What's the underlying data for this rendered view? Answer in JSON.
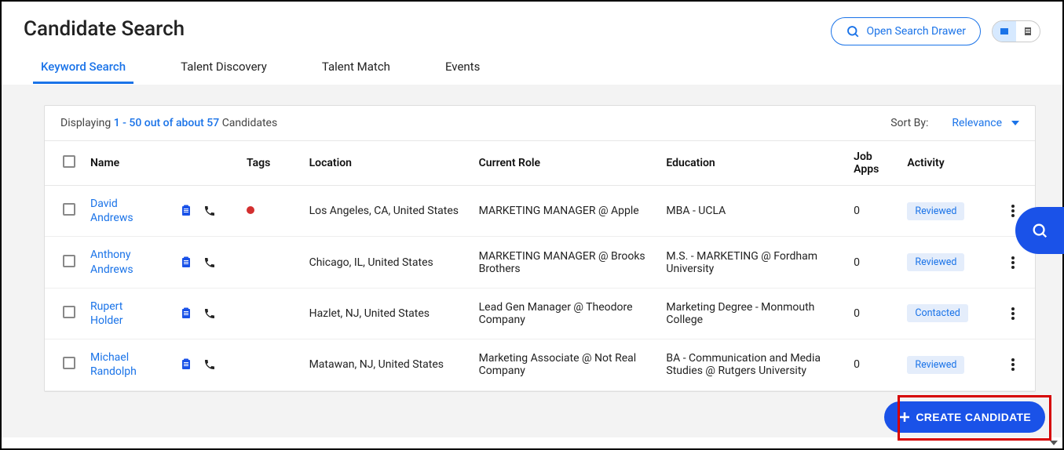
{
  "header": {
    "title": "Candidate Search",
    "open_search_drawer": "Open Search Drawer"
  },
  "tabs": [
    {
      "label": "Keyword Search",
      "active": true
    },
    {
      "label": "Talent Discovery",
      "active": false
    },
    {
      "label": "Talent Match",
      "active": false
    },
    {
      "label": "Events",
      "active": false
    }
  ],
  "results_bar": {
    "displaying_prefix": "Displaying ",
    "count_range": "1 - 50 out of about 57",
    "displaying_suffix": " Candidates",
    "sort_label": "Sort By:",
    "sort_value": "Relevance"
  },
  "columns": {
    "name": "Name",
    "tags": "Tags",
    "location": "Location",
    "current_role": "Current Role",
    "education": "Education",
    "job_apps": "Job Apps",
    "activity": "Activity"
  },
  "rows": [
    {
      "name": "David Andrews",
      "tag_color": "#d32f2f",
      "location": "Los Angeles, CA, United States",
      "role": "MARKETING MANAGER @ Apple",
      "education": "MBA - UCLA",
      "apps": "0",
      "activity": "Reviewed"
    },
    {
      "name": "Anthony Andrews",
      "tag_color": "",
      "location": "Chicago, IL, United States",
      "role": "MARKETING MANAGER @ Brooks Brothers",
      "education": "M.S. - MARKETING @ Fordham University",
      "apps": "0",
      "activity": "Reviewed"
    },
    {
      "name": "Rupert Holder",
      "tag_color": "",
      "location": "Hazlet, NJ, United States",
      "role": "Lead Gen Manager @ Theodore Company",
      "education": "Marketing Degree - Monmouth College",
      "apps": "0",
      "activity": "Contacted"
    },
    {
      "name": "Michael Randolph",
      "tag_color": "",
      "location": "Matawan, NJ, United States",
      "role": "Marketing Associate @ Not Real Company",
      "education": "BA - Communication and Media Studies @ Rutgers University",
      "apps": "0",
      "activity": "Reviewed"
    }
  ],
  "buttons": {
    "create_candidate": "CREATE CANDIDATE"
  }
}
